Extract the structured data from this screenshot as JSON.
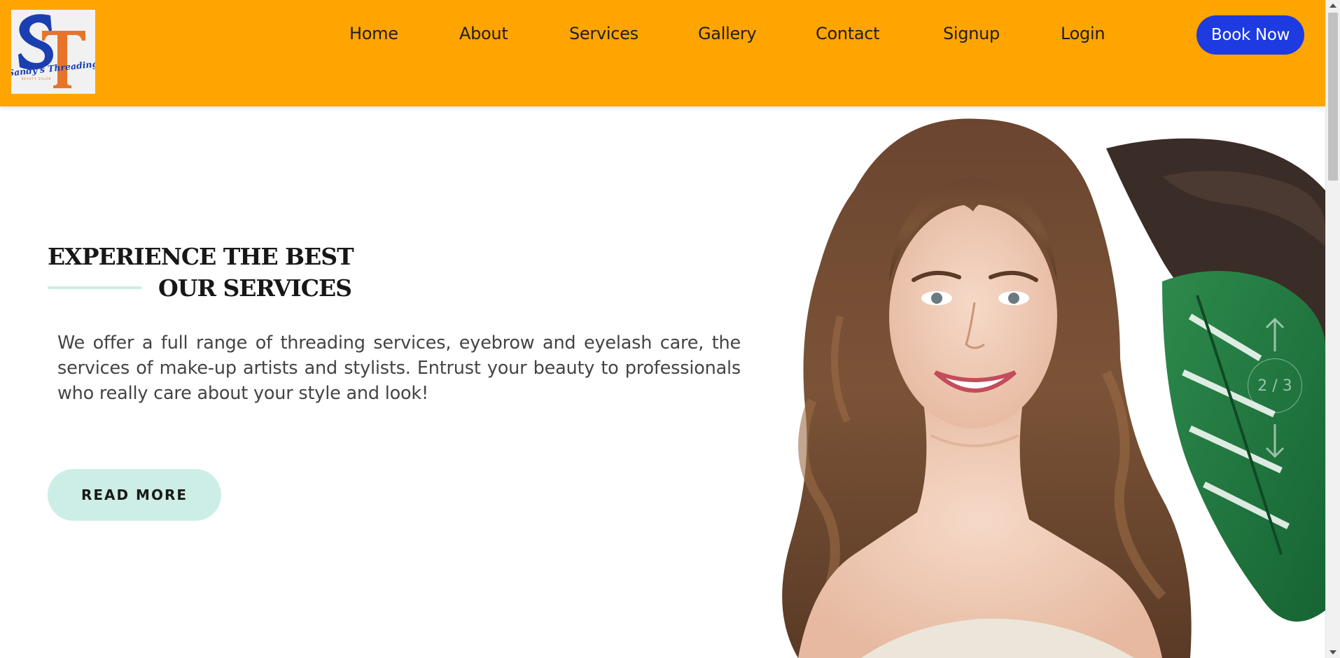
{
  "header": {
    "logo": {
      "initials": "ST",
      "brand": "Sandy's Threading",
      "tagline": "BEAUTY SALON",
      "colors": {
        "s": "#1b3fb0",
        "t": "#e8742a",
        "bg": "#f1f1f1"
      }
    },
    "nav": [
      {
        "label": "Home"
      },
      {
        "label": "About"
      },
      {
        "label": "Services"
      },
      {
        "label": "Gallery"
      },
      {
        "label": "Contact"
      },
      {
        "label": "Signup"
      },
      {
        "label": "Login"
      }
    ],
    "book_button": "Book Now",
    "colors": {
      "background": "#ffa502",
      "button": "#1d3be0"
    }
  },
  "hero": {
    "title_line1": "EXPERIENCE THE BEST",
    "title_line2": "OUR SERVICES",
    "description": "We offer a full range of threading services, eyebrow and eyelash care, the services of make-up artists and stylists. Entrust your beauty to professionals who really care about your style and look!",
    "read_more": "READ MORE",
    "accent_color": "#cdeee6",
    "image": {
      "subject": "smiling woman with long wavy brown hair, monstera leaves"
    }
  },
  "slider": {
    "counter": "2 / 3",
    "up_icon": "arrow-up-icon",
    "down_icon": "arrow-down-icon"
  }
}
